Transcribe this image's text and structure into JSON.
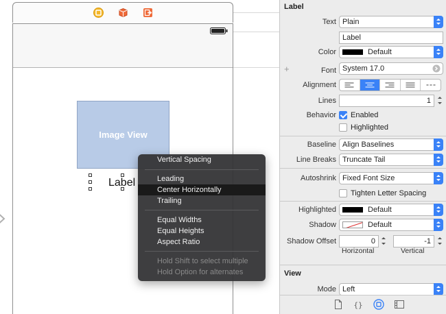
{
  "canvas": {
    "image_view_label": "Image View",
    "label_text": "Label"
  },
  "context_menu": {
    "items": [
      {
        "label": "Vertical Spacing",
        "state": "normal"
      },
      {
        "label": "Leading",
        "state": "normal"
      },
      {
        "label": "Center Horizontally",
        "state": "highlighted"
      },
      {
        "label": "Trailing",
        "state": "normal"
      },
      {
        "label": "Equal Widths",
        "state": "normal"
      },
      {
        "label": "Equal Heights",
        "state": "normal"
      },
      {
        "label": "Aspect Ratio",
        "state": "normal"
      },
      {
        "label": "Hold Shift to select multiple",
        "state": "disabled"
      },
      {
        "label": "Hold Option for alternates",
        "state": "disabled"
      }
    ]
  },
  "inspector": {
    "label_section": {
      "title": "Label",
      "text_label": "Text",
      "text_type": "Plain",
      "text_value": "Label",
      "color_label": "Color",
      "color_value": "Default",
      "font_label": "Font",
      "font_value": "System 17.0",
      "alignment_label": "Alignment",
      "alignment_selected": "center",
      "lines_label": "Lines",
      "lines_value": "1",
      "behavior_label": "Behavior",
      "enabled_label": "Enabled",
      "enabled_checked": true,
      "highlighted_cb_label": "Highlighted",
      "highlighted_checked": false,
      "baseline_label": "Baseline",
      "baseline_value": "Align Baselines",
      "line_breaks_label": "Line Breaks",
      "line_breaks_value": "Truncate Tail",
      "autoshrink_label": "Autoshrink",
      "autoshrink_value": "Fixed Font Size",
      "tighten_label": "Tighten Letter Spacing",
      "tighten_checked": false,
      "highlighted_label": "Highlighted",
      "highlighted_value": "Default",
      "shadow_label": "Shadow",
      "shadow_value": "Default",
      "shadow_offset_label": "Shadow Offset",
      "shadow_offset_h": "0",
      "shadow_offset_v": "-1",
      "horizontal_label": "Horizontal",
      "vertical_label": "Vertical"
    },
    "view_section": {
      "title": "View",
      "mode_label": "Mode",
      "mode_value": "Left"
    },
    "colors": {
      "accent": "#3a82f7",
      "image_view_fill": "#b8cbe7",
      "menu_bg": "#343436"
    }
  },
  "icons": [
    "view-controller-icon",
    "first-responder-icon",
    "exit-icon",
    "battery-icon",
    "plus-icon",
    "font-picker-icon",
    "file-inspector-icon",
    "quick-help-icon",
    "identity-inspector-icon",
    "library-icon",
    "entry-point-arrow-icon"
  ]
}
